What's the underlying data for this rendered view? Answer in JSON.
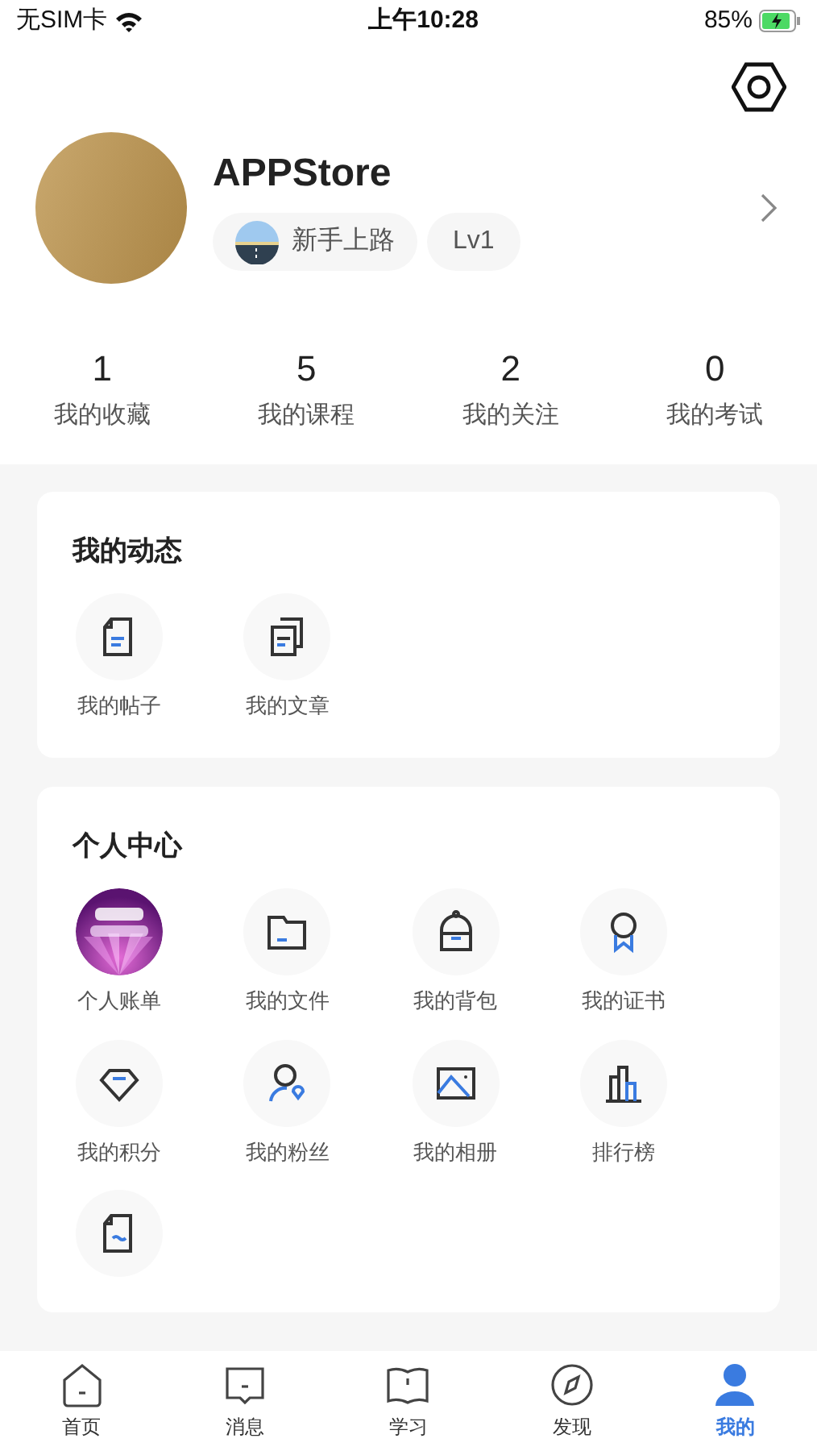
{
  "status_bar": {
    "carrier": "无SIM卡",
    "time": "上午10:28",
    "battery": "85%"
  },
  "profile": {
    "name": "APPStore",
    "badge": "新手上路",
    "level": "Lv1"
  },
  "stats": [
    {
      "value": "1",
      "label": "我的收藏"
    },
    {
      "value": "5",
      "label": "我的课程"
    },
    {
      "value": "2",
      "label": "我的关注"
    },
    {
      "value": "0",
      "label": "我的考试"
    }
  ],
  "sections": [
    {
      "title": "我的动态",
      "items": [
        {
          "kind": "post",
          "label": "我的帖子"
        },
        {
          "kind": "article",
          "label": "我的文章"
        }
      ]
    },
    {
      "title": "个人中心",
      "items": [
        {
          "kind": "picture",
          "label": "个人账单"
        },
        {
          "kind": "folder",
          "label": "我的文件"
        },
        {
          "kind": "bag",
          "label": "我的背包"
        },
        {
          "kind": "certificate",
          "label": "我的证书"
        },
        {
          "kind": "gem",
          "label": "我的积分"
        },
        {
          "kind": "fans",
          "label": "我的粉丝"
        },
        {
          "kind": "album",
          "label": "我的相册"
        },
        {
          "kind": "ranking",
          "label": "排行榜"
        },
        {
          "kind": "draft"
        }
      ]
    }
  ],
  "tabs": [
    {
      "kind": "home",
      "label": "首页",
      "selected": false
    },
    {
      "kind": "message",
      "label": "消息",
      "selected": false
    },
    {
      "kind": "study",
      "label": "学习",
      "selected": false
    },
    {
      "kind": "discover",
      "label": "发现",
      "selected": false
    },
    {
      "kind": "me",
      "label": "我的",
      "selected": true
    }
  ]
}
